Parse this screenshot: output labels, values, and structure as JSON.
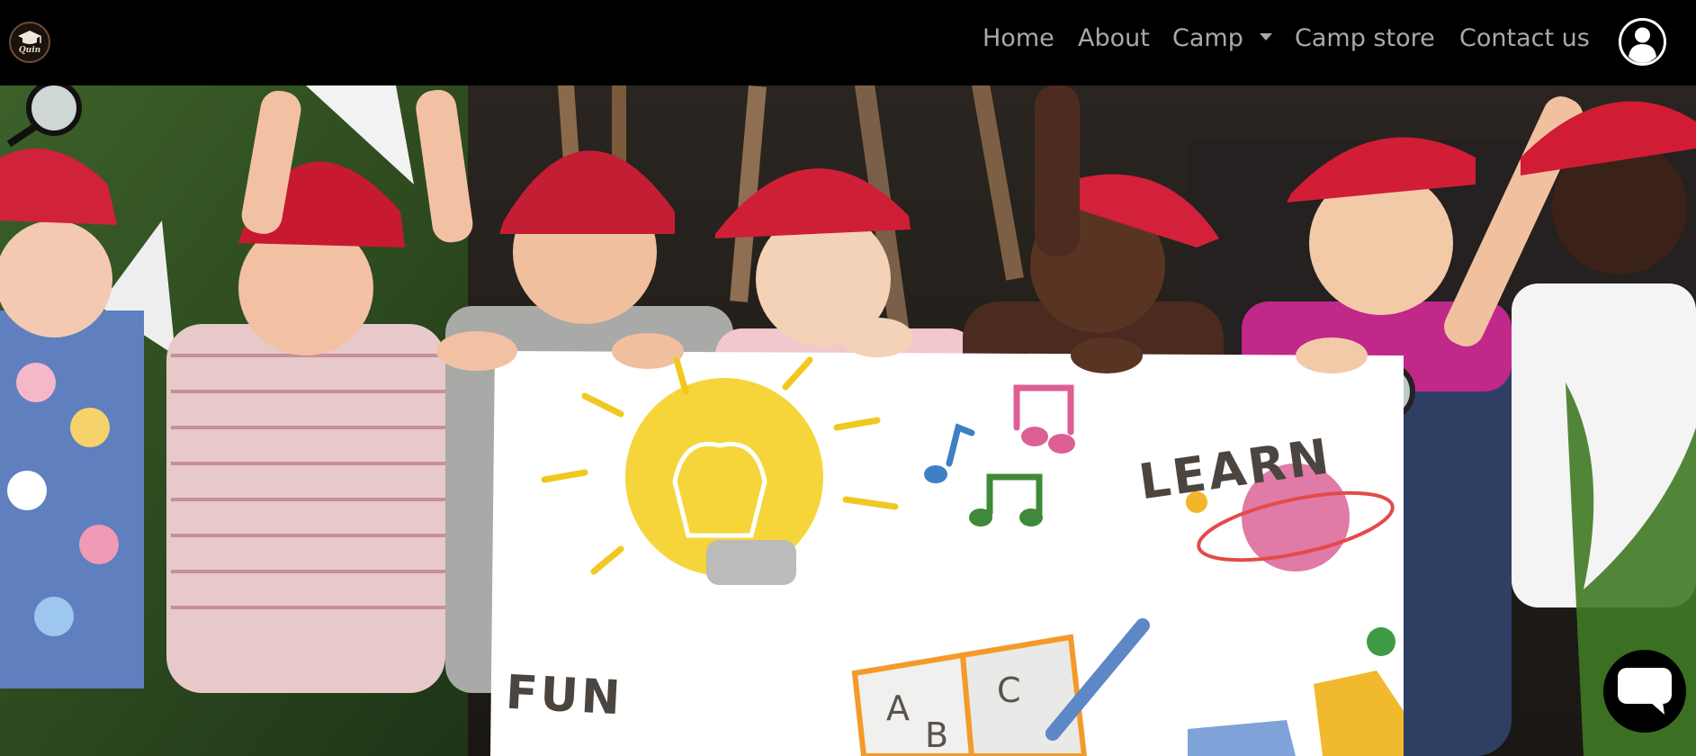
{
  "brand": {
    "logo_text": "Quin",
    "logo_icon": "graduation-cap-icon"
  },
  "nav": {
    "items": [
      {
        "label": "Home"
      },
      {
        "label": "About"
      },
      {
        "label": "Camp",
        "has_dropdown": true
      },
      {
        "label": "Camp store"
      },
      {
        "label": "Contact us"
      }
    ],
    "account_icon": "user-circle-icon"
  },
  "hero": {
    "sign": {
      "word_learn": "LEARN",
      "word_fun": "FUN",
      "book_letters": [
        "A",
        "B",
        "C"
      ]
    }
  },
  "chat": {
    "icon": "chat-bubble-icon"
  },
  "colors": {
    "navbar_bg": "#000000",
    "nav_text": "#a9a9a9",
    "cap_red": "#d0223a"
  }
}
